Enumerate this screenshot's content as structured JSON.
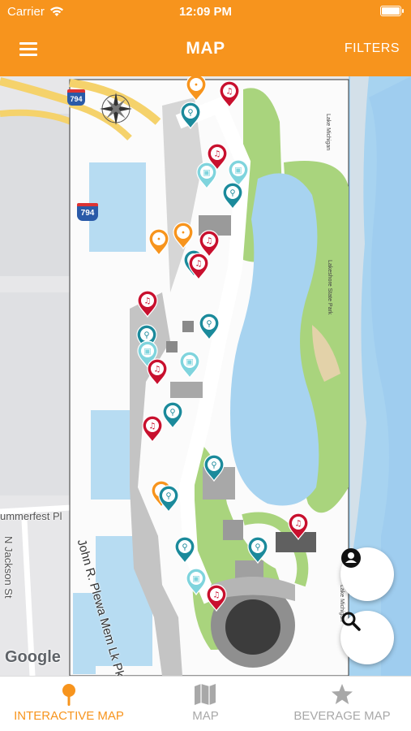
{
  "status_bar": {
    "carrier": "Carrier",
    "time": "12:09 PM"
  },
  "header": {
    "title": "MAP",
    "filters_label": "FILTERS"
  },
  "map": {
    "street_labels": {
      "parkway": "John R. Plewa Mem Lk Pkwy",
      "summerfest": "ummerfest Pl",
      "jackson": "N Jackson St",
      "st": "St"
    },
    "highway_shield": "794",
    "attribution": "Google"
  },
  "tabs": [
    {
      "label": "INTERACTIVE MAP",
      "icon": "pin-icon",
      "active": true
    },
    {
      "label": "MAP",
      "icon": "folded-map-icon",
      "active": false
    },
    {
      "label": "BEVERAGE MAP",
      "icon": "star-icon",
      "active": false
    }
  ],
  "colors": {
    "brand_orange": "#f7941d",
    "stage_red": "#c8102e",
    "restroom_teal": "#1b8a9b",
    "atm_light_teal": "#7fd4dd",
    "food_orange": "#f7941d",
    "lake_blue": "#a7d3f0"
  }
}
